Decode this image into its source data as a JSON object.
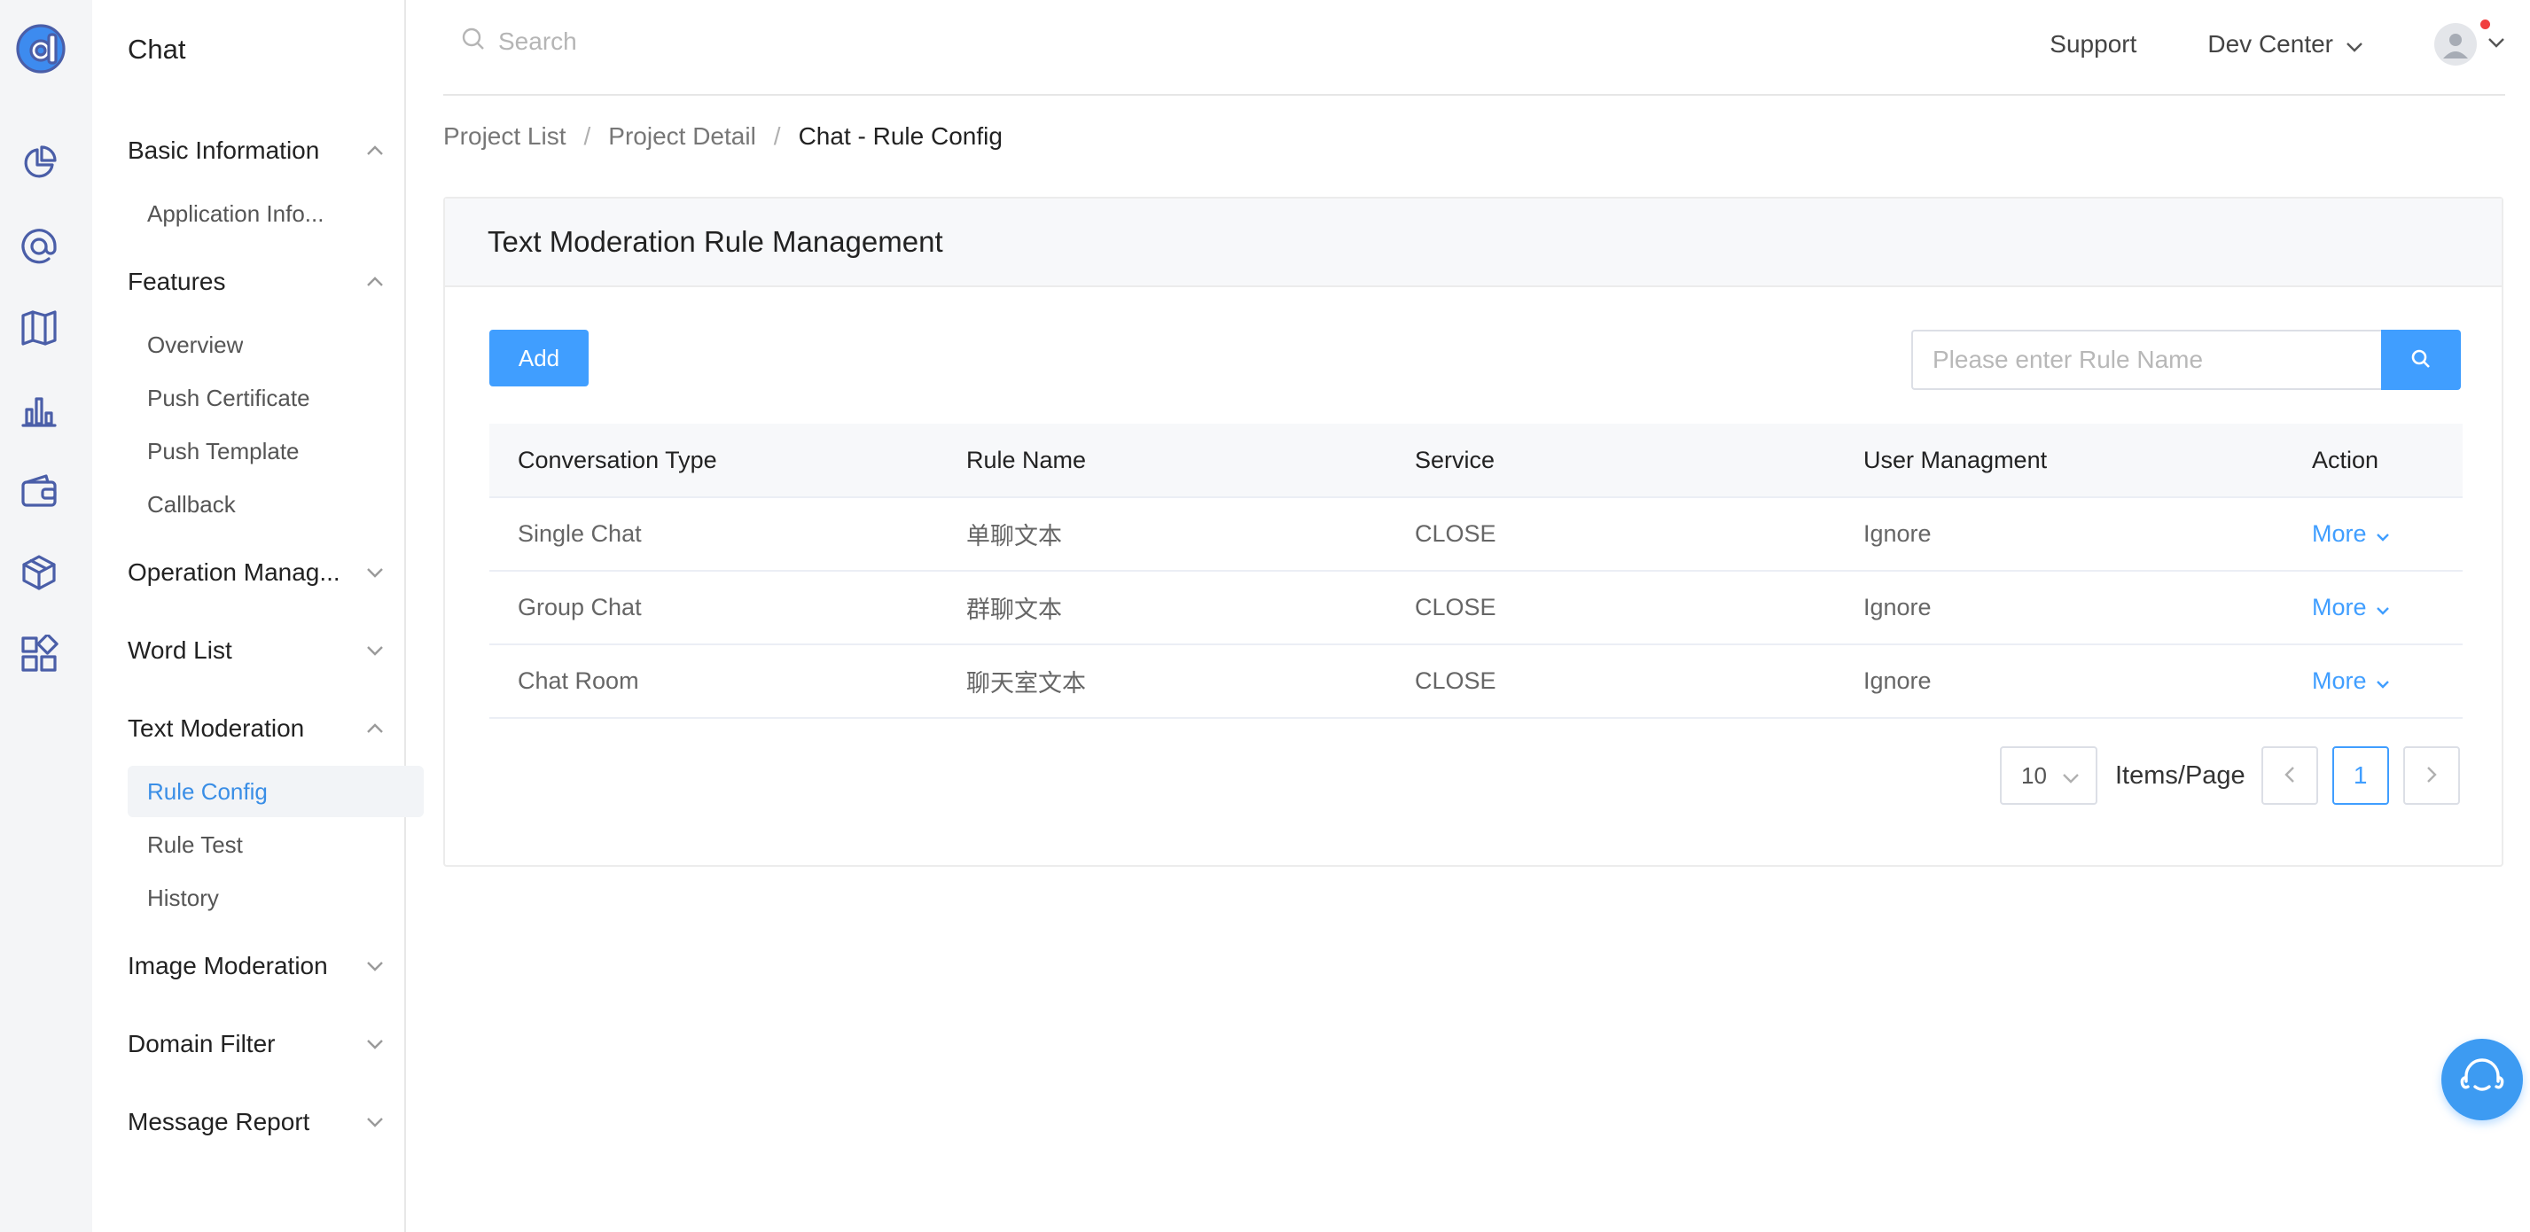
{
  "rail": {
    "icons": [
      "logo-icon",
      "pie-chart-icon",
      "at-sign-icon",
      "map-icon",
      "bar-chart-icon",
      "wallet-icon",
      "box-icon",
      "apps-icon"
    ]
  },
  "sidebar": {
    "title": "Chat",
    "groups": [
      {
        "label": "Basic Information",
        "expanded": true,
        "items": [
          "Application Info..."
        ]
      },
      {
        "label": "Features",
        "expanded": true,
        "items": [
          "Overview",
          "Push Certificate",
          "Push Template",
          "Callback"
        ]
      },
      {
        "label": "Operation Manag...",
        "expanded": false,
        "items": []
      },
      {
        "label": "Word List",
        "expanded": false,
        "items": []
      },
      {
        "label": "Text Moderation",
        "expanded": true,
        "items": [
          "Rule Config",
          "Rule Test",
          "History"
        ],
        "active_item": "Rule Config"
      },
      {
        "label": "Image Moderation",
        "expanded": false,
        "items": []
      },
      {
        "label": "Domain Filter",
        "expanded": false,
        "items": []
      },
      {
        "label": "Message Report",
        "expanded": false,
        "items": []
      }
    ]
  },
  "topbar": {
    "search_placeholder": "Search",
    "support": "Support",
    "dev_center": "Dev Center"
  },
  "breadcrumb": [
    "Project List",
    "Project Detail",
    "Chat - Rule Config"
  ],
  "card": {
    "title": "Text Moderation Rule Management",
    "add_label": "Add",
    "search_placeholder": "Please enter Rule Name"
  },
  "table": {
    "headers": [
      "Conversation Type",
      "Rule Name",
      "Service",
      "User Managment",
      "Action"
    ],
    "rows": [
      [
        "Single Chat",
        "单聊文本",
        "CLOSE",
        "Ignore",
        "More"
      ],
      [
        "Group Chat",
        "群聊文本",
        "CLOSE",
        "Ignore",
        "More"
      ],
      [
        "Chat Room",
        "聊天室文本",
        "CLOSE",
        "Ignore",
        "More"
      ]
    ]
  },
  "pagination": {
    "page_size": "10",
    "items_label": "Items/Page",
    "current_page": "1"
  },
  "colors": {
    "accent": "#409eff",
    "rail_icon": "#4a5ea8",
    "notification_dot": "#f04040"
  }
}
